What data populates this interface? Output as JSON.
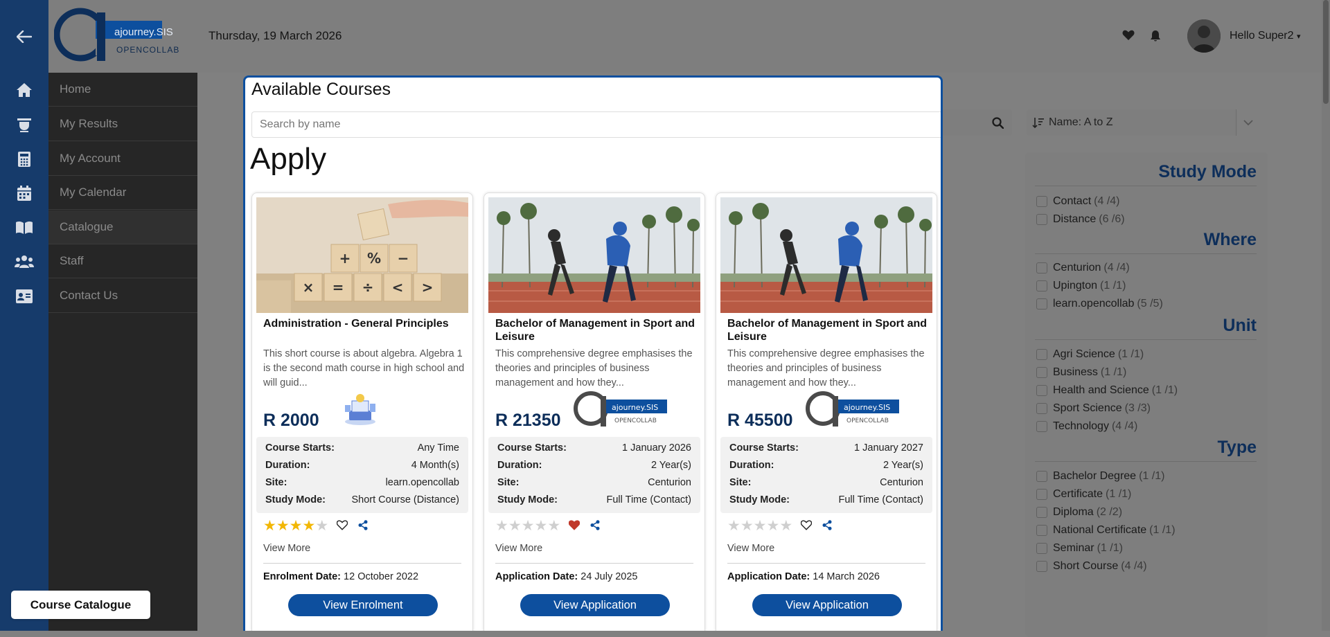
{
  "header": {
    "date": "Thursday, 19 March 2026",
    "greeting": "Hello Super2",
    "logo_text": "ajourney.SIS",
    "logo_sub": "OPENCOLLAB"
  },
  "sidebar": {
    "items": [
      {
        "label": "Home",
        "icon": "home-icon"
      },
      {
        "label": "My Results",
        "icon": "graduation-icon"
      },
      {
        "label": "My Account",
        "icon": "calculator-icon"
      },
      {
        "label": "My Calendar",
        "icon": "calendar-icon"
      },
      {
        "label": "Catalogue",
        "icon": "book-icon"
      },
      {
        "label": "Staff",
        "icon": "users-icon"
      },
      {
        "label": "Contact Us",
        "icon": "id-card-icon"
      }
    ]
  },
  "sort": {
    "label": "Name: A to Z"
  },
  "filters": {
    "study_mode": {
      "title": "Study Mode",
      "items": [
        {
          "name": "Contact",
          "count": "(4 /4)"
        },
        {
          "name": "Distance",
          "count": "(6 /6)"
        }
      ]
    },
    "where": {
      "title": "Where",
      "items": [
        {
          "name": "Centurion",
          "count": "(4 /4)"
        },
        {
          "name": "Upington",
          "count": "(1 /1)"
        },
        {
          "name": "learn.opencollab",
          "count": "(5 /5)"
        }
      ]
    },
    "unit": {
      "title": "Unit",
      "items": [
        {
          "name": "Agri Science",
          "count": "(1 /1)"
        },
        {
          "name": "Business",
          "count": "(1 /1)"
        },
        {
          "name": "Health and Science",
          "count": "(1 /1)"
        },
        {
          "name": "Sport Science",
          "count": "(3 /3)"
        },
        {
          "name": "Technology",
          "count": "(4 /4)"
        }
      ]
    },
    "type": {
      "title": "Type",
      "items": [
        {
          "name": "Bachelor Degree",
          "count": "(1 /1)"
        },
        {
          "name": "Certificate",
          "count": "(1 /1)"
        },
        {
          "name": "Diploma",
          "count": "(2 /2)"
        },
        {
          "name": "National Certificate",
          "count": "(1 /1)"
        },
        {
          "name": "Seminar",
          "count": "(1 /1)"
        },
        {
          "name": "Short Course",
          "count": "(4 /4)"
        }
      ]
    }
  },
  "modal": {
    "title": "Available Courses",
    "search_placeholder": "Search by name",
    "heading": "Apply",
    "labels": {
      "starts": "Course Starts:",
      "duration": "Duration:",
      "site": "Site:",
      "mode": "Study Mode:",
      "view_more": "View More"
    },
    "cards": [
      {
        "title": "Administration - General Principles",
        "description": "This short course is about algebra. Algebra 1 is the second math course in high school and will guid...",
        "price": "R 2000",
        "starts": "Any Time",
        "duration": "4 Month(s)",
        "site": "learn.opencollab",
        "mode": "Short Course (Distance)",
        "rating": 4,
        "favourited": false,
        "date_label": "Enrolment Date:",
        "date_value": "12 October 2022",
        "button": "View Enrolment"
      },
      {
        "title": "Bachelor of Management in Sport and Leisure",
        "description": "This comprehensive degree emphasises the theories and principles of business management and how they...",
        "price": "R 21350",
        "starts": "1 January 2026",
        "duration": "2 Year(s)",
        "site": "Centurion",
        "mode": "Full Time (Contact)",
        "rating": 0,
        "favourited": true,
        "date_label": "Application Date:",
        "date_value": "24 July 2025",
        "button": "View Application"
      },
      {
        "title": "Bachelor of Management in Sport and Leisure",
        "description": "This comprehensive degree emphasises the theories and principles of business management and how they...",
        "price": "R 45500",
        "starts": "1 January 2027",
        "duration": "2 Year(s)",
        "site": "Centurion",
        "mode": "Full Time (Contact)",
        "rating": 0,
        "favourited": false,
        "date_label": "Application Date:",
        "date_value": "14 March 2026",
        "button": "View Application"
      }
    ]
  },
  "footer_tag": "Course Catalogue",
  "colors": {
    "brand": "#0d4f9e",
    "rail": "#163b6b",
    "star": "#f2b705",
    "heart": "#c0392b"
  }
}
